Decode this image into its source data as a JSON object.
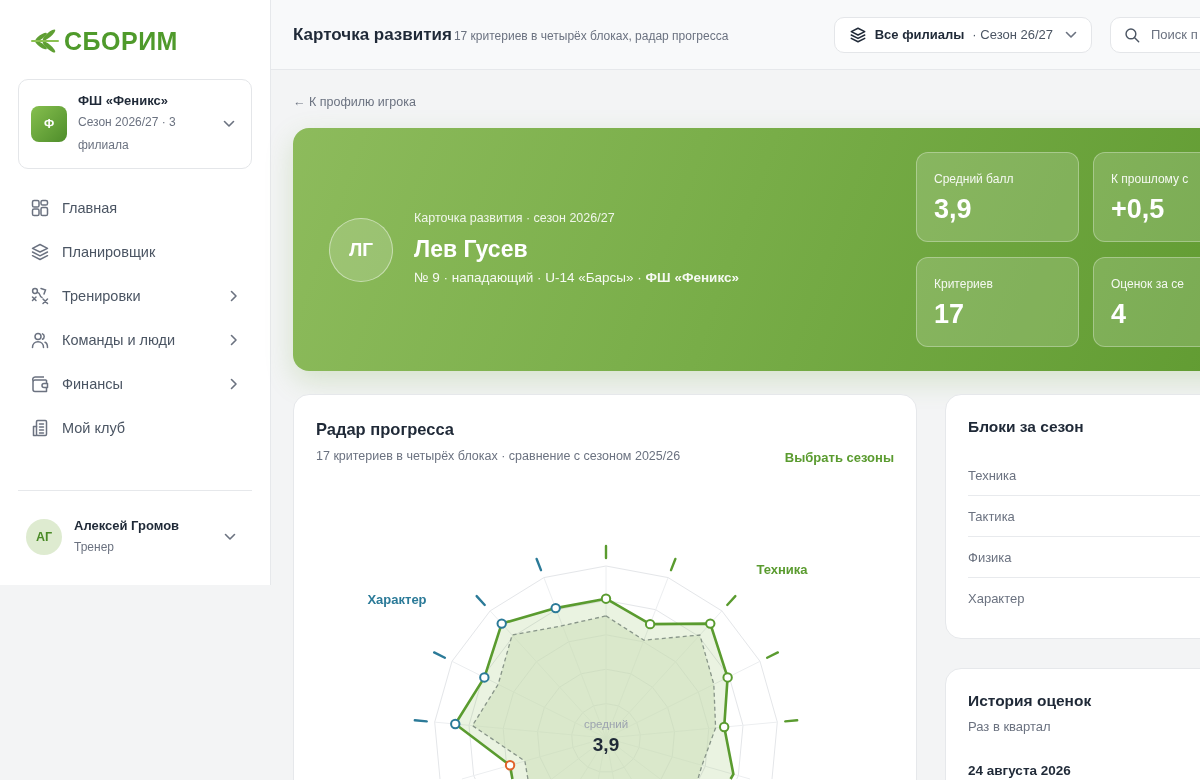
{
  "sidebar": {
    "logo": "СБОРИМ",
    "club": {
      "initial": "Ф",
      "name": "ФШ «Феникс»",
      "meta": "Сезон 2026/27 · 3 филиала"
    },
    "nav": [
      {
        "label": "Главная",
        "selected": false,
        "expandable": false
      },
      {
        "label": "Планировщик",
        "selected": false,
        "expandable": false
      },
      {
        "label": "Тренировки",
        "selected": false,
        "expandable": true
      },
      {
        "label": "Команды и люди",
        "selected": false,
        "expandable": true
      },
      {
        "label": "Финансы",
        "selected": false,
        "expandable": true
      },
      {
        "label": "Мой клуб",
        "selected": false,
        "expandable": false
      }
    ],
    "user": {
      "initials": "АГ",
      "name": "Алексей Громов",
      "role": "Тренер"
    }
  },
  "header": {
    "title": "Карточка развития",
    "subtitle": "17 критериев в четырёх блоках, радар прогресса",
    "branch_selector": {
      "label": "Все филиалы",
      "season": "· Сезон 26/27"
    },
    "search": {
      "placeholder": "Поиск п"
    }
  },
  "back_link": "← К профилю игрока",
  "player_card": {
    "initials": "ЛГ",
    "caption": "Карточка развития · сезон 2026/27",
    "name": "Лев Гусев",
    "details": "№ 9 · нападающий · U-14 «Барсы» · **ФШ «Феникс»**",
    "stats": [
      {
        "label": "Средний балл",
        "value": "3,9"
      },
      {
        "label": "К прошлому с",
        "value": "+0,5"
      },
      {
        "label": "Критериев",
        "value": "17"
      },
      {
        "label": "Оценок за се",
        "value": "4"
      }
    ]
  },
  "radar": {
    "title": "Радар прогресса",
    "subtitle": "17 критериев в четырёх блоках · сравнение с сезоном 2025/26",
    "action": "Выбрать сезоны",
    "block_labels": [
      {
        "text": "Техника",
        "color": "#5a9b2f"
      },
      {
        "text": "Характер",
        "color": "#2b7a98"
      }
    ],
    "center_label": "средний",
    "center_value": "3,9"
  },
  "season_blocks": {
    "title": "Блоки за сезон",
    "rows": [
      "Техника",
      "Тактика",
      "Физика",
      "Характер"
    ]
  },
  "history": {
    "title": "История оценок",
    "subtitle": "Раз в квартал",
    "entries": [
      {
        "date": "24 августа 2026"
      }
    ]
  }
}
